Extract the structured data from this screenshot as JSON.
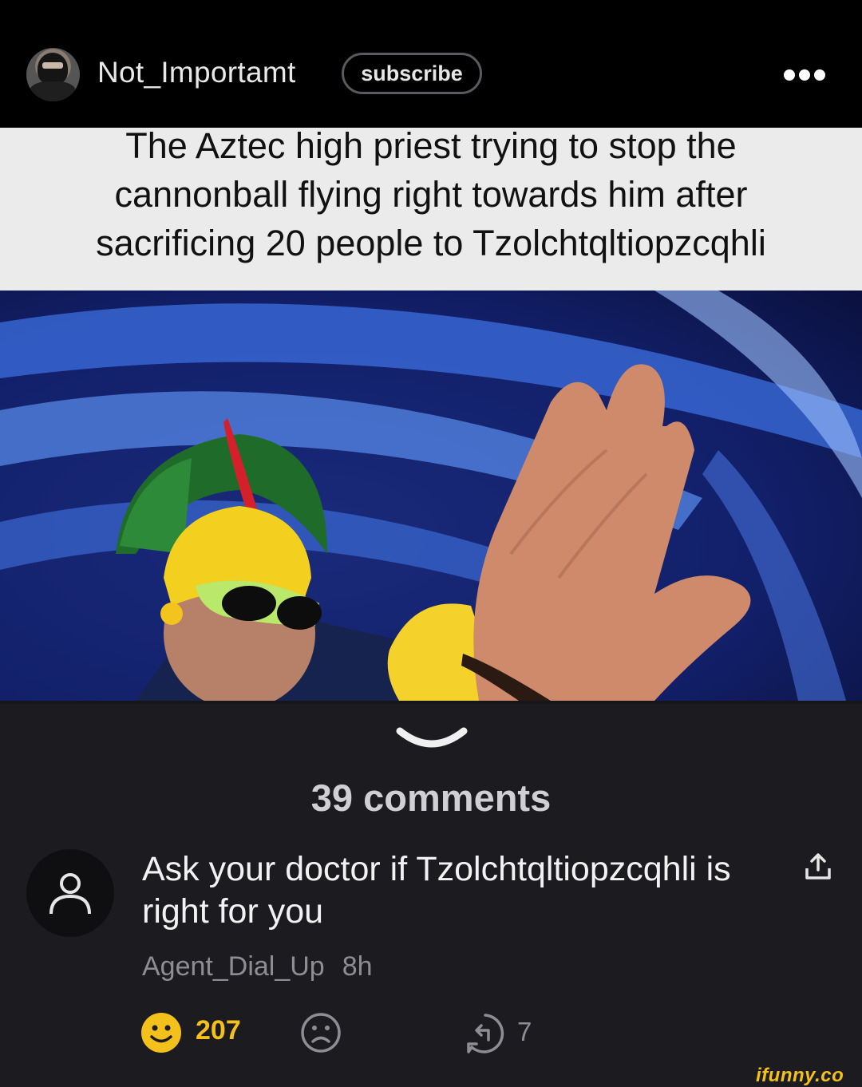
{
  "header": {
    "username": "Not_Importamt",
    "subscribe_label": "subscribe",
    "more_icon": "more-dots-icon"
  },
  "post": {
    "caption_lines": [
      "The Aztec high priest trying to stop the",
      "cannonball flying right towards him after",
      "sacrificing 20 people to Tzolchtqltiopzcqhli"
    ]
  },
  "comments": {
    "count_label": "39 comments",
    "items": [
      {
        "text": "Ask your doctor if Tzolchtqltiopzcqhli is right for you",
        "author": "Agent_Dial_Up",
        "time": "8h",
        "smiles": "207",
        "replies": "7"
      }
    ]
  },
  "watermark": "ifunny.co",
  "colors": {
    "smile_accent": "#f4c01b",
    "background": "#1c1c20",
    "header_bg": "#000000"
  }
}
